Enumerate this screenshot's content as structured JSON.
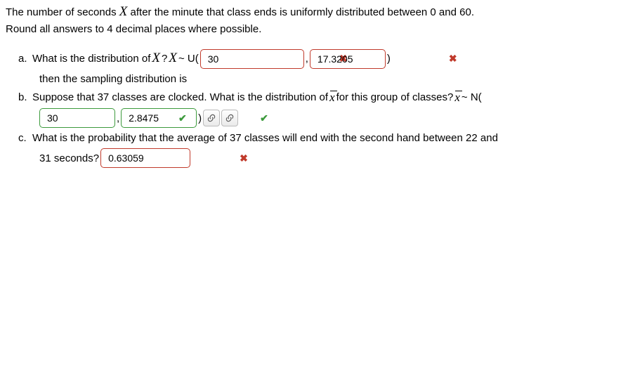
{
  "intro_line1": "The number of seconds ",
  "intro_var": "X",
  "intro_line1b": " after the minute that class ends is uniformly distributed between 0 and 60.",
  "intro_line2": "Round all answers to 4 decimal places where possible.",
  "qa": {
    "label": "a.",
    "text1": "What is the distribution of ",
    "var1": "X",
    "text2": "? ",
    "var2": "X",
    "text3": " ~ U(",
    "input1": "30",
    "input2": "17.3205",
    "comma": ",",
    "close": ")",
    "sub": "then the sampling distribution is"
  },
  "qb": {
    "label": "b.",
    "text1": "Suppose that 37 classes are clocked.  What is the distribution of ",
    "text2": " for this group of classes? ",
    "text3": " ~ N(",
    "input1": "30",
    "input2": "2.8475",
    "comma": ",",
    "close": ")"
  },
  "qc": {
    "label": "c.",
    "text1": "What is the probability that the average of 37 classes will end with the second hand between 22 and",
    "text2": "31 seconds?",
    "input1": "0.63059"
  }
}
